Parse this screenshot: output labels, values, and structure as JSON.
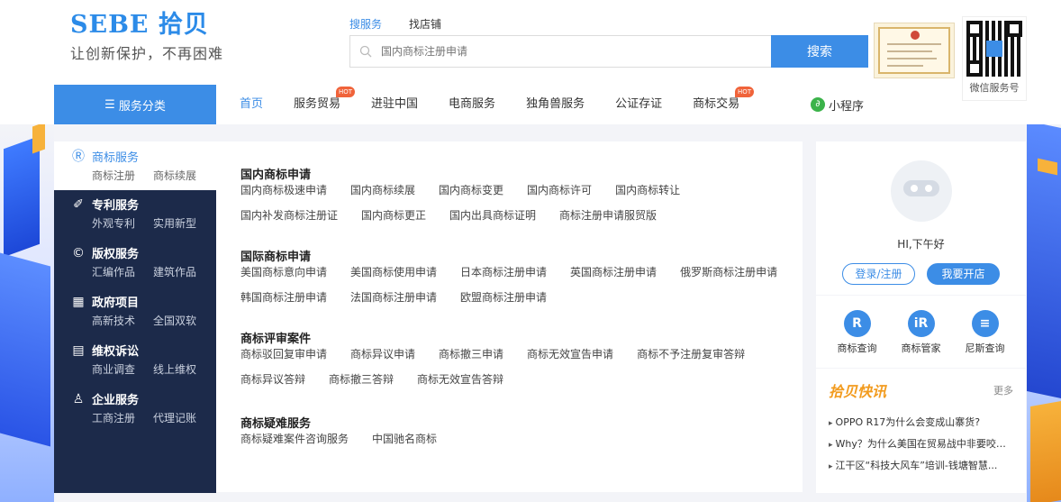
{
  "logo": {
    "main": "SEBE 拾贝",
    "slogan": "让创新保护，不再困难"
  },
  "search": {
    "tabs": [
      "搜服务",
      "找店铺"
    ],
    "placeholder": "国内商标注册申请",
    "button": "搜索"
  },
  "qr": {
    "caption": "微信服务号"
  },
  "category_header": "服务分类",
  "nav": {
    "items": [
      {
        "label": "首页"
      },
      {
        "label": "服务贸易",
        "badge": "HOT"
      },
      {
        "label": "进驻中国"
      },
      {
        "label": "电商服务"
      },
      {
        "label": "独角兽服务"
      },
      {
        "label": "公证存证"
      },
      {
        "label": "商标交易",
        "badge": "HOT"
      }
    ],
    "mini_program": "小程序"
  },
  "sidebar": {
    "items": [
      {
        "title": "商标服务",
        "icon": "Ⓡ",
        "links": [
          "商标注册",
          "商标续展"
        ]
      },
      {
        "title": "专利服务",
        "icon": "✐",
        "links": [
          "外观专利",
          "实用新型"
        ]
      },
      {
        "title": "版权服务",
        "icon": "©",
        "links": [
          "汇编作品",
          "建筑作品"
        ]
      },
      {
        "title": "政府项目",
        "icon": "▦",
        "links": [
          "高新技术",
          "全国双软"
        ]
      },
      {
        "title": "维权诉讼",
        "icon": "▤",
        "links": [
          "商业调查",
          "线上维权"
        ]
      },
      {
        "title": "企业服务",
        "icon": "♙",
        "links": [
          "工商注册",
          "代理记账"
        ]
      }
    ]
  },
  "panel": {
    "groups": [
      {
        "title": "国内商标申请",
        "links": [
          "国内商标极速申请",
          "国内商标续展",
          "国内商标变更",
          "国内商标许可",
          "国内商标转让",
          "国内补发商标注册证",
          "国内商标更正",
          "国内出具商标证明",
          "商标注册申请服贸版"
        ]
      },
      {
        "title": "国际商标申请",
        "links": [
          "美国商标意向申请",
          "美国商标使用申请",
          "日本商标注册申请",
          "英国商标注册申请",
          "俄罗斯商标注册申请",
          "韩国商标注册申请",
          "法国商标注册申请",
          "欧盟商标注册申请"
        ]
      },
      {
        "title": "商标评审案件",
        "links": [
          "商标驳回复审申请",
          "商标异议申请",
          "商标撤三申请",
          "商标无效宣告申请",
          "商标不予注册复审答辩",
          "商标异议答辩",
          "商标撤三答辩",
          "商标无效宣告答辩"
        ]
      },
      {
        "title": "商标疑难服务",
        "links": [
          "商标疑难案件咨询服务",
          "中国驰名商标"
        ]
      }
    ]
  },
  "user": {
    "greeting": "HI,下午好",
    "login": "登录/注册",
    "open_store": "我要开店"
  },
  "tools": [
    {
      "label": "商标查询",
      "icon": "R"
    },
    {
      "label": "商标管家",
      "icon": "iR"
    },
    {
      "label": "尼斯查询",
      "icon": "≡"
    }
  ],
  "news": {
    "title": "拾贝快讯",
    "more": "更多",
    "items": [
      "OPPO R17为什么会变成山寨货?",
      "Why？为什么美国在贸易战中非要咬住...",
      "江干区“科技大风车”培训-钱塘智慧..."
    ]
  },
  "colors": {
    "accent": "#3c8de6",
    "hot": "#f0633a",
    "sidebar": "#1c2a4a",
    "news": "#f29b1e"
  }
}
